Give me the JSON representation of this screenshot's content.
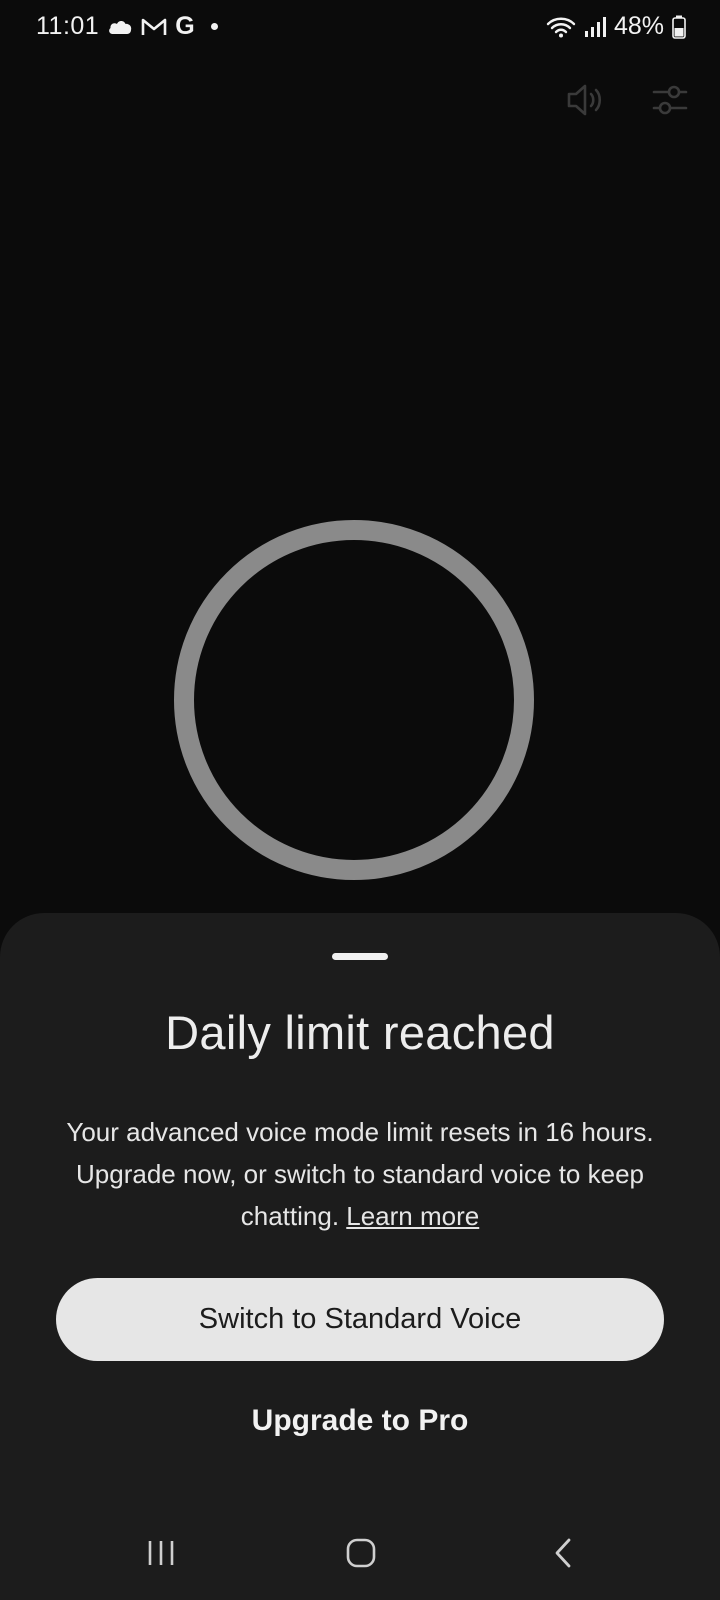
{
  "status_bar": {
    "time": "11:01",
    "left_icons": [
      "cloud-icon",
      "gmail-icon",
      "google-g-icon",
      "notification-dot-icon"
    ],
    "google_label": "G",
    "battery_percent": "48%",
    "right_icons": [
      "wifi-icon",
      "signal-icon",
      "battery-icon"
    ]
  },
  "top_controls": {
    "speaker_icon": "speaker-icon",
    "settings_icon": "sliders-icon"
  },
  "sheet": {
    "title": "Daily limit reached",
    "body_text": "Your advanced voice mode limit resets in 16 hours. Upgrade now, or switch to standard voice to keep chatting.",
    "learn_more_label": "Learn more",
    "primary_button_label": "Switch to Standard Voice",
    "secondary_button_label": "Upgrade to Pro"
  },
  "nav_bar": {
    "icons": [
      "recents-icon",
      "home-icon",
      "back-icon"
    ]
  },
  "colors": {
    "background": "#0b0b0b",
    "sheet_background": "#1c1c1c",
    "orb_ring": "#8a8a8a",
    "primary_button": "#e6e6e6"
  }
}
